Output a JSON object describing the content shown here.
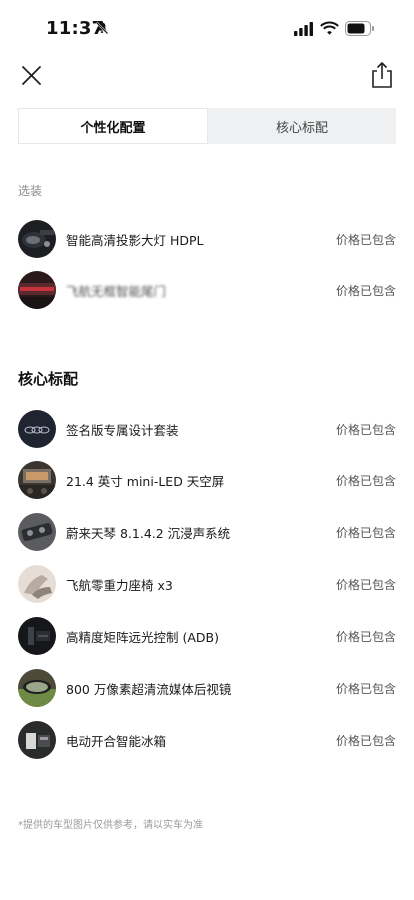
{
  "status_bar": {
    "time": "11:37"
  },
  "header": {
    "close_icon": "close-icon",
    "share_icon": "share-icon"
  },
  "tabs": [
    {
      "label": "个性化配置",
      "active": true
    },
    {
      "label": "核心标配",
      "active": false
    }
  ],
  "options_section": {
    "label": "选装",
    "items": [
      {
        "name": "智能高清投影大灯 HDPL",
        "status": "价格已包含"
      },
      {
        "name": "飞航无框智能尾门",
        "status": "价格已包含"
      }
    ]
  },
  "core_section": {
    "heading": "核心标配",
    "items": [
      {
        "name": "签名版专属设计套装",
        "status": "价格已包含"
      },
      {
        "name": "21.4 英寸 mini-LED 天空屏",
        "status": "价格已包含"
      },
      {
        "name": "蔚来天琴 8.1.4.2 沉浸声系统",
        "status": "价格已包含"
      },
      {
        "name": "飞航零重力座椅 x3",
        "status": "价格已包含"
      },
      {
        "name": "高精度矩阵远光控制 (ADB)",
        "status": "价格已包含"
      },
      {
        "name": "800 万像素超清流媒体后视镜",
        "status": "价格已包含"
      },
      {
        "name": "电动开合智能冰箱",
        "status": "价格已包含"
      }
    ]
  },
  "footnote": "*提供的车型图片仅供参考，请以实车为准",
  "colors": {
    "text": "#111111",
    "muted": "#8a8a8a",
    "tab_bg": "#eef0f2"
  }
}
